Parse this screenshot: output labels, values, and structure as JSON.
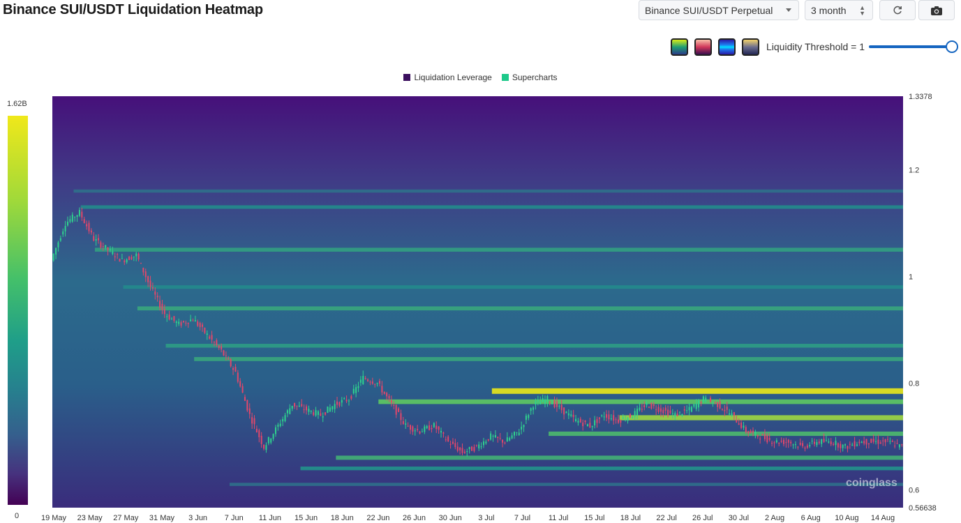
{
  "header": {
    "title": "Binance SUI/USDT Liquidation Heatmap",
    "pair_select_value": "Binance SUI/USDT Perpetual",
    "range_select_value": "3 month",
    "refresh_icon": "refresh-icon",
    "camera_icon": "camera-icon"
  },
  "controls": {
    "threshold_label": "Liquidity Threshold = 1",
    "threshold_value": 1,
    "palettes": [
      "viridis",
      "magma",
      "blue-cyan",
      "cividis"
    ]
  },
  "legend": [
    {
      "label": "Liquidation Leverage",
      "color": "#3b0f5e"
    },
    {
      "label": "Supercharts",
      "color": "#1ec98a"
    }
  ],
  "colorbar": {
    "max_label": "1.62B",
    "min_label": "0"
  },
  "watermark": "coinglass",
  "chart_data": {
    "type": "heatmap",
    "title": "Binance SUI/USDT Liquidation Heatmap",
    "ylim": [
      0.56638,
      1.3378
    ],
    "y_ticks": [
      "1.3378",
      "1.2",
      "1",
      "0.8",
      "0.6",
      "0.56638"
    ],
    "x_ticks": [
      "19 May",
      "23 May",
      "27 May",
      "31 May",
      "3 Jun",
      "7 Jun",
      "11 Jun",
      "15 Jun",
      "18 Jun",
      "22 Jun",
      "26 Jun",
      "30 Jun",
      "3 Jul",
      "7 Jul",
      "11 Jul",
      "15 Jul",
      "18 Jul",
      "22 Jul",
      "26 Jul",
      "30 Jul",
      "2 Aug",
      "6 Aug",
      "10 Aug",
      "14 Aug"
    ],
    "price_path": [
      [
        0,
        1.03
      ],
      [
        2,
        1.1
      ],
      [
        4,
        1.12
      ],
      [
        6,
        1.07
      ],
      [
        8,
        1.05
      ],
      [
        10,
        1.03
      ],
      [
        12,
        1.04
      ],
      [
        14,
        0.98
      ],
      [
        16,
        0.93
      ],
      [
        18,
        0.91
      ],
      [
        20,
        0.92
      ],
      [
        22,
        0.89
      ],
      [
        24,
        0.86
      ],
      [
        26,
        0.82
      ],
      [
        28,
        0.74
      ],
      [
        30,
        0.68
      ],
      [
        32,
        0.72
      ],
      [
        34,
        0.76
      ],
      [
        36,
        0.75
      ],
      [
        38,
        0.74
      ],
      [
        40,
        0.76
      ],
      [
        42,
        0.77
      ],
      [
        44,
        0.81
      ],
      [
        46,
        0.8
      ],
      [
        48,
        0.76
      ],
      [
        50,
        0.72
      ],
      [
        52,
        0.71
      ],
      [
        54,
        0.72
      ],
      [
        56,
        0.69
      ],
      [
        58,
        0.67
      ],
      [
        60,
        0.68
      ],
      [
        62,
        0.7
      ],
      [
        64,
        0.69
      ],
      [
        66,
        0.71
      ],
      [
        68,
        0.76
      ],
      [
        70,
        0.77
      ],
      [
        72,
        0.75
      ],
      [
        74,
        0.73
      ],
      [
        76,
        0.72
      ],
      [
        78,
        0.74
      ],
      [
        80,
        0.73
      ],
      [
        82,
        0.74
      ],
      [
        84,
        0.76
      ],
      [
        86,
        0.75
      ],
      [
        88,
        0.74
      ],
      [
        90,
        0.75
      ],
      [
        92,
        0.77
      ],
      [
        94,
        0.76
      ],
      [
        96,
        0.74
      ],
      [
        98,
        0.71
      ],
      [
        100,
        0.7
      ],
      [
        102,
        0.69
      ],
      [
        104,
        0.69
      ],
      [
        106,
        0.68
      ],
      [
        108,
        0.69
      ],
      [
        110,
        0.69
      ],
      [
        112,
        0.68
      ],
      [
        114,
        0.69
      ],
      [
        116,
        0.69
      ],
      [
        118,
        0.69
      ],
      [
        120,
        0.68
      ]
    ],
    "liquidity_levels": [
      {
        "price": 0.785,
        "intensity": 1.0,
        "start_day": 62
      },
      {
        "price": 0.735,
        "intensity": 0.85,
        "start_day": 80
      },
      {
        "price": 0.765,
        "intensity": 0.72,
        "start_day": 46
      },
      {
        "price": 0.705,
        "intensity": 0.65,
        "start_day": 70
      },
      {
        "price": 0.845,
        "intensity": 0.55,
        "start_day": 20
      },
      {
        "price": 0.87,
        "intensity": 0.5,
        "start_day": 16
      },
      {
        "price": 0.94,
        "intensity": 0.55,
        "start_day": 12
      },
      {
        "price": 0.98,
        "intensity": 0.42,
        "start_day": 10
      },
      {
        "price": 1.05,
        "intensity": 0.52,
        "start_day": 6
      },
      {
        "price": 1.13,
        "intensity": 0.42,
        "start_day": 4
      },
      {
        "price": 1.16,
        "intensity": 0.3,
        "start_day": 3
      },
      {
        "price": 0.66,
        "intensity": 0.6,
        "start_day": 40
      },
      {
        "price": 0.64,
        "intensity": 0.45,
        "start_day": 35
      },
      {
        "price": 0.61,
        "intensity": 0.3,
        "start_day": 25
      }
    ],
    "day_range": [
      0,
      120
    ],
    "grid": false
  }
}
